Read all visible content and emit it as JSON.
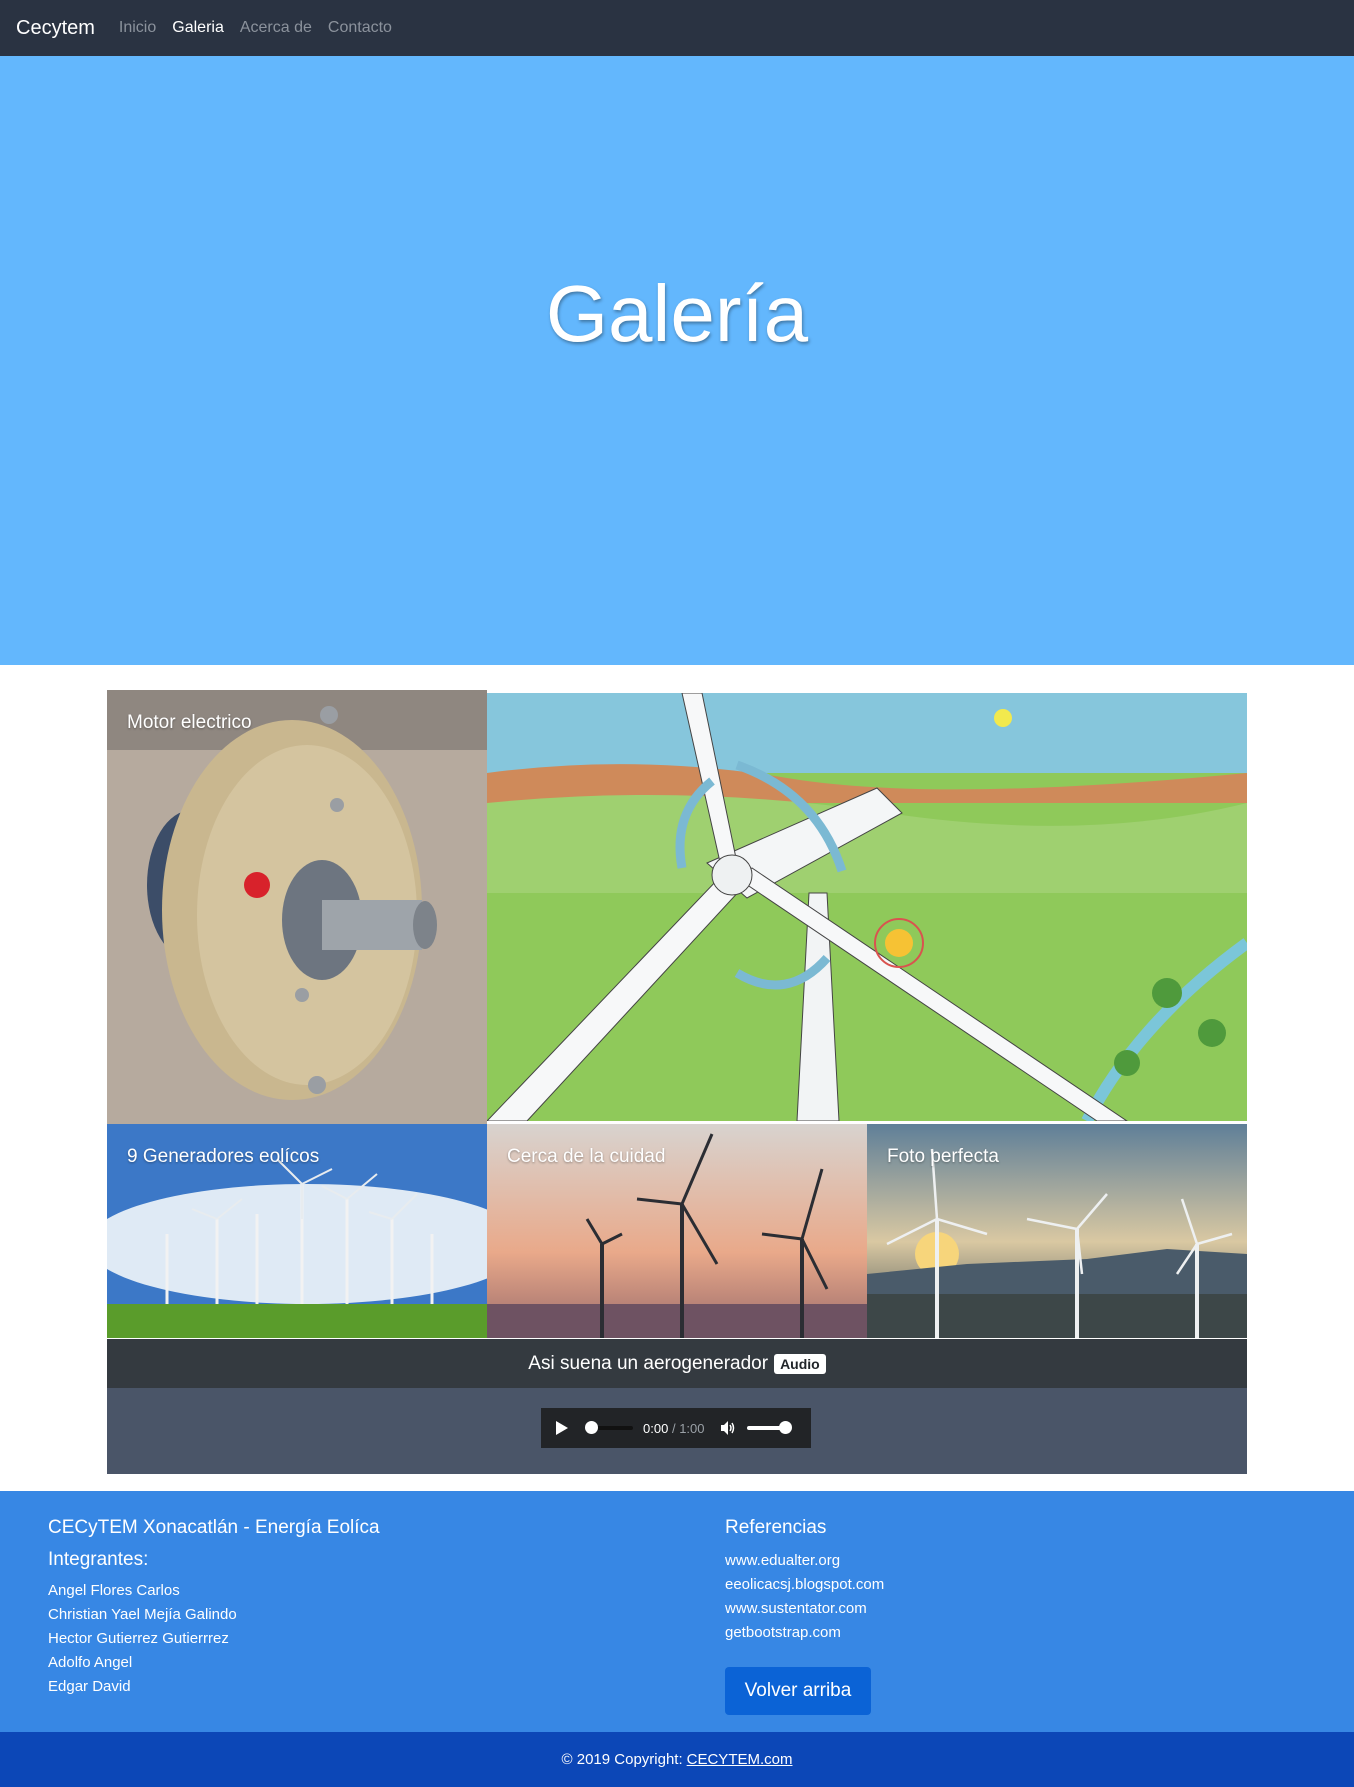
{
  "navbar": {
    "brand": "Cecytem",
    "links": [
      {
        "label": "Inicio"
      },
      {
        "label": "Galeria"
      },
      {
        "label": "Acerca de"
      },
      {
        "label": "Contacto"
      }
    ]
  },
  "hero": {
    "title": "Galería"
  },
  "gallery": {
    "tiles": [
      {
        "caption": "Motor electrico"
      },
      {
        "caption": ""
      },
      {
        "caption": "9 Generadores eolícos"
      },
      {
        "caption": "Cerca de la cuidad"
      },
      {
        "caption": "Foto perfecta"
      }
    ]
  },
  "audio": {
    "title": "Asi suena un aerogenerador",
    "badge": "Audio",
    "current_time": "0:00",
    "separator": "/",
    "duration": "1:00",
    "position": 0,
    "volume": 1
  },
  "footer": {
    "site_name": "CECyTEM Xonacatlán - Energía Eolíca",
    "members_heading": "Integrantes:",
    "members": [
      "Angel Flores Carlos",
      "Christian Yael Mejía Galindo",
      "Hector Gutierrez Gutierrrez",
      "Adolfo Angel",
      "Edgar David"
    ],
    "references_heading": "Referencias",
    "references": [
      "www.edualter.org",
      "eeolicacsj.blogspot.com",
      "www.sustentator.com",
      "getbootstrap.com"
    ],
    "back_to_top": "Volver arriba"
  },
  "copyright": {
    "text": "© 2019 Copyright:",
    "link": "CECYTEM.com"
  },
  "colors": {
    "navbar": "#2a3342",
    "hero": "#63b7fd",
    "footer": "#3787e4",
    "copyright_bar": "#0c47b7",
    "button": "#0b63d6"
  }
}
